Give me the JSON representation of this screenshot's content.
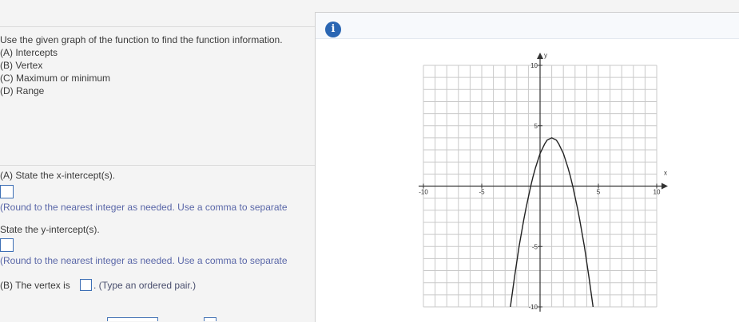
{
  "question": {
    "prompt": "Use the given graph of the function to find the function information.",
    "parts": [
      "(A) Intercepts",
      "(B) Vertex",
      "(C) Maximum or minimum",
      "(D) Range"
    ]
  },
  "answers": {
    "x_intercept_label": "(A) State the x-intercept(s).",
    "x_intercept_hint": "(Round to the nearest integer as needed. Use a comma to separate",
    "y_intercept_label": "State the y-intercept(s).",
    "y_intercept_hint": "(Round to the nearest integer as needed. Use a comma to separate",
    "vertex_label": "(B) The vertex is",
    "vertex_hint": ". (Type an ordered pair.)"
  },
  "info_icon": {
    "glyph": "i",
    "name": "info-icon",
    "color": "#2a66b3"
  },
  "chart_data": {
    "type": "line",
    "xlim": [
      -10,
      10
    ],
    "ylim": [
      -10,
      10
    ],
    "grid": true,
    "xlabel": "x",
    "ylabel": "y",
    "x_ticks": [
      -10,
      -5,
      5,
      10
    ],
    "y_ticks": [
      10,
      5,
      -5,
      -10
    ],
    "series": [
      {
        "color": "#222222",
        "x": [
          -2.6,
          -2.4,
          -2.2,
          -2.0,
          -1.8,
          -1.6,
          -1.4,
          -1.2,
          -1.0,
          -0.8,
          -0.6,
          -0.4,
          -0.2,
          0.0,
          0.2,
          0.4,
          0.6,
          0.8,
          1.0,
          1.2,
          1.4,
          1.6,
          1.8,
          2.0,
          2.2,
          2.4,
          2.6,
          2.8,
          3.0,
          3.2,
          3.4,
          3.6,
          3.8,
          4.0,
          4.2,
          4.4,
          4.6
        ],
        "y": [
          -10.4,
          -9.0,
          -7.6,
          -6.3,
          -5.0,
          -3.9,
          -2.8,
          -1.8,
          -0.9,
          0.0,
          0.8,
          1.5,
          2.1,
          2.7,
          3.1,
          3.5,
          3.8,
          3.9,
          4.0,
          3.9,
          3.8,
          3.5,
          3.1,
          2.7,
          2.1,
          1.5,
          0.8,
          0.0,
          -0.9,
          -1.8,
          -2.8,
          -3.9,
          -5.0,
          -6.3,
          -7.6,
          -9.0,
          -10.4
        ]
      }
    ]
  }
}
